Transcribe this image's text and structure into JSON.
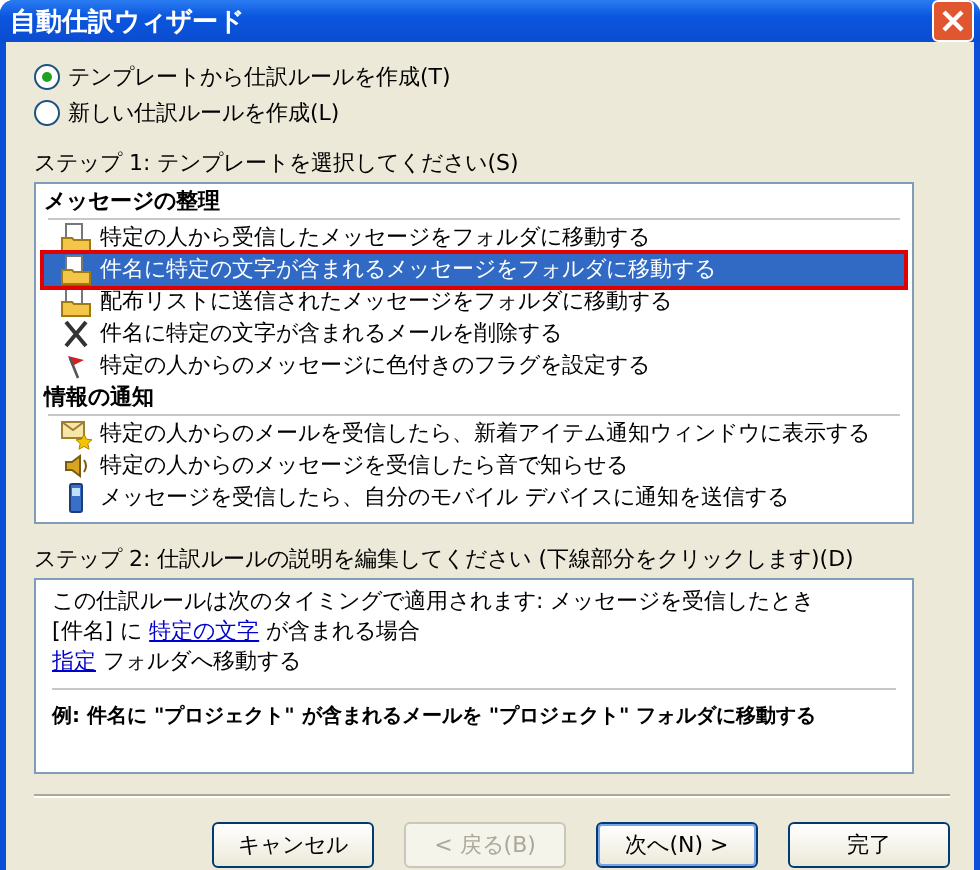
{
  "window": {
    "title": "自動仕訳ウィザード"
  },
  "options": [
    {
      "label": "テンプレートから仕訳ルールを作成(T)",
      "selected": true
    },
    {
      "label": "新しい仕訳ルールを作成(L)",
      "selected": false
    }
  ],
  "step1_label": "ステップ 1: テンプレートを選択してください(S)",
  "template_groups": [
    {
      "heading": "メッセージの整理",
      "items": [
        {
          "kind": "move",
          "label": "特定の人から受信したメッセージをフォルダに移動する",
          "selected": false
        },
        {
          "kind": "move",
          "label": "件名に特定の文字が含まれるメッセージをフォルダに移動する",
          "selected": true
        },
        {
          "kind": "move",
          "label": "配布リストに送信されたメッセージをフォルダに移動する",
          "selected": false
        },
        {
          "kind": "delete",
          "label": "件名に特定の文字が含まれるメールを削除する",
          "selected": false
        },
        {
          "kind": "flag",
          "label": "特定の人からのメッセージに色付きのフラグを設定する",
          "selected": false
        }
      ]
    },
    {
      "heading": "情報の通知",
      "items": [
        {
          "kind": "alert",
          "label": "特定の人からのメールを受信したら、新着アイテム通知ウィンドウに表示する",
          "selected": false
        },
        {
          "kind": "sound",
          "label": "特定の人からのメッセージを受信したら音で知らせる",
          "selected": false
        },
        {
          "kind": "mobile",
          "label": "メッセージを受信したら、自分のモバイル デバイスに通知を送信する",
          "selected": false
        }
      ]
    }
  ],
  "step2_label": "ステップ 2: 仕訳ルールの説明を編集してください (下線部分をクリックします)(D)",
  "description": {
    "lines": [
      [
        {
          "text": "この仕訳ルールは次のタイミングで適用されます: メッセージを受信したとき",
          "link": false
        }
      ],
      [
        {
          "text": "[件名] に ",
          "link": false
        },
        {
          "text": "特定の文字",
          "link": true
        },
        {
          "text": " が含まれる場合",
          "link": false
        }
      ],
      [
        {
          "text": "指定",
          "link": true
        },
        {
          "text": " フォルダへ移動する",
          "link": false
        }
      ]
    ],
    "example": "例: 件名に \"プロジェクト\" が含まれるメールを \"プロジェクト\" フォルダに移動する"
  },
  "buttons": [
    {
      "label": "キャンセル",
      "disabled": false,
      "default": false
    },
    {
      "label": "< 戻る(B)",
      "disabled": true,
      "default": false
    },
    {
      "label": "次へ(N) >",
      "disabled": false,
      "default": true
    },
    {
      "label": "完了",
      "disabled": false,
      "default": false
    }
  ]
}
